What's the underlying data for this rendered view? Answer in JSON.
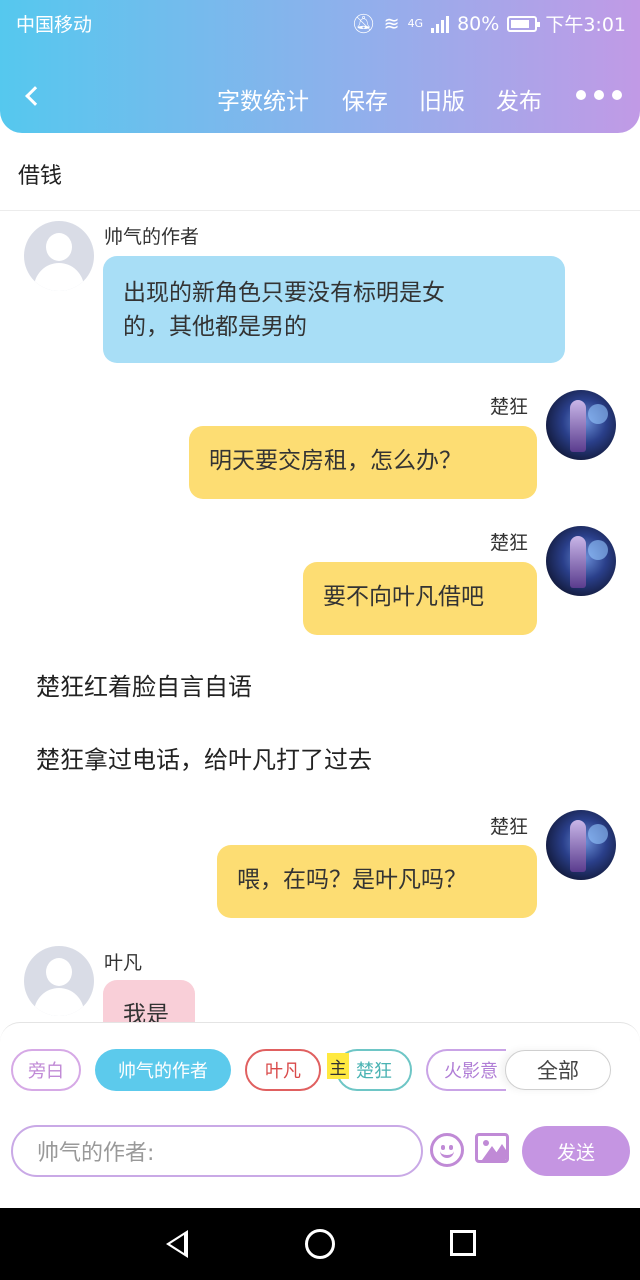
{
  "status_bar": {
    "carrier": "中国移动",
    "network": "4G",
    "battery": "80%",
    "time": "下午3:01"
  },
  "nav": {
    "word_count": "字数统计",
    "save": "保存",
    "old_version": "旧版",
    "publish": "发布"
  },
  "title": "借钱",
  "messages": [
    {
      "name": "帅气的作者",
      "text": "出现的新角色只要没有标明是女的，其他都是男的",
      "line1": "出现的新角色只要没有标明是女",
      "line2": "的，其他都是男的"
    },
    {
      "name": "楚狂",
      "text": "明天要交房租，怎么办？"
    },
    {
      "name": "楚狂",
      "text": "要不向叶凡借吧"
    },
    {
      "narration": "楚狂红着脸自言自语"
    },
    {
      "narration": "楚狂拿过电话，给叶凡打了过去"
    },
    {
      "name": "楚狂",
      "text": "喂，在吗？是叶凡吗？"
    },
    {
      "name": "叶凡",
      "text": "我是"
    }
  ],
  "roles": {
    "aside": "旁白",
    "author": "帅气的作者",
    "yefan": "叶凡",
    "main_tag": "主",
    "chukuang": "楚狂",
    "huoying": "火影意",
    "all": "全部"
  },
  "input": {
    "placeholder": "帅气的作者:",
    "send": "发送"
  },
  "colors": {
    "header_gradient_start": "#55c8ee",
    "header_gradient_end": "#c19ae6",
    "author_bubble": "#a8def6",
    "chukuang_bubble": "#fddd73",
    "yefan_bubble": "#f9cfd8",
    "accent_purple": "#c595e2"
  }
}
